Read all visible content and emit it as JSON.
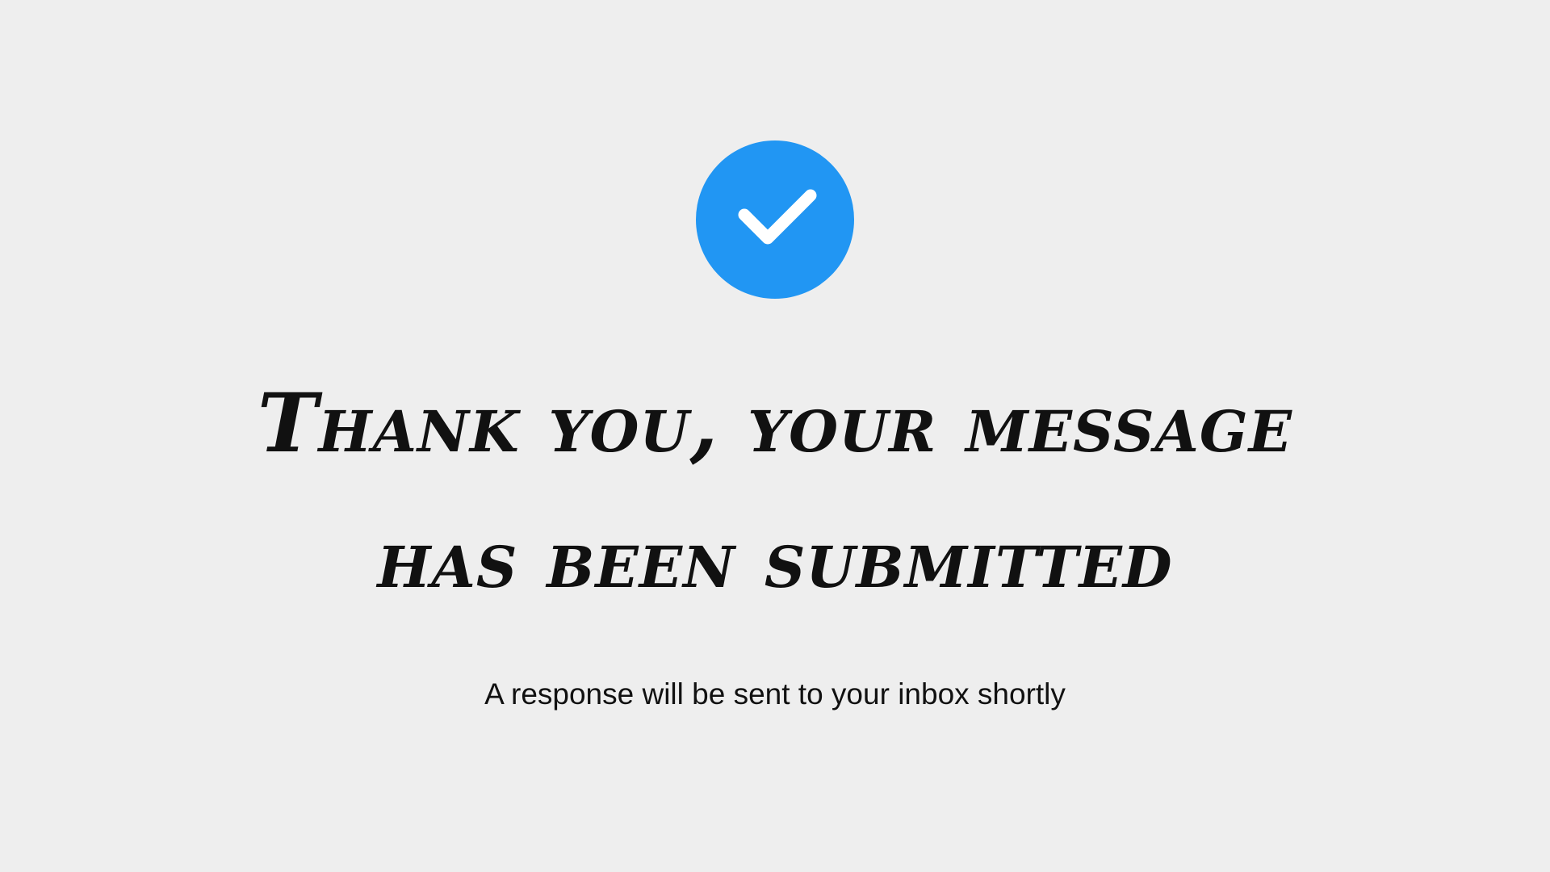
{
  "confirmation": {
    "icon": "checkmark-icon",
    "accent_color": "#2196f3",
    "background_color": "#eeeeee",
    "headline_line1": "Thank you, your message",
    "headline_line2": "has been submitted",
    "subtext": "A response will be sent to your inbox shortly"
  }
}
